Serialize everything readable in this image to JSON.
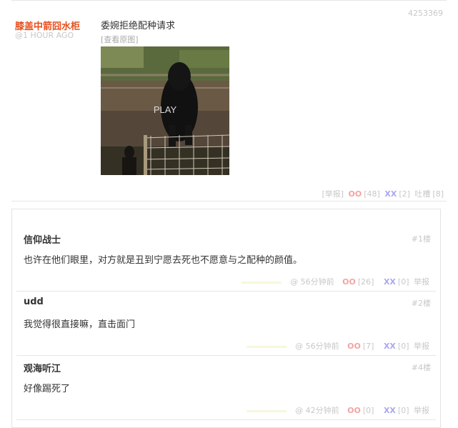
{
  "post": {
    "id": "4253369",
    "author": "膝盖中箭囧水柜",
    "time": "@1 HOUR AGO",
    "text": "委婉拒绝配种请求",
    "view_original": "[查看原图]",
    "media_label": "PLAY",
    "report": "[举报]",
    "oo_label": "OO",
    "oo_count": "[48]",
    "xx_label": "XX",
    "xx_count": "[2]",
    "tucao_label": "吐槽",
    "tucao_count": "[8]"
  },
  "comments": [
    {
      "author": "信仰战士",
      "floor": "#1楼",
      "text": "也许在他们眼里，对方就是丑到宁愿去死也不愿意与之配种的颜值。",
      "time": "@ 56分钟前",
      "oo_label": "OO",
      "oo": "[26]",
      "xx_label": "XX",
      "xx": "[0]",
      "report": "举报"
    },
    {
      "author": "udd",
      "floor": "#2楼",
      "text": "我觉得很直接嘛，直击面门",
      "time": "@ 56分钟前",
      "oo_label": "OO",
      "oo": "[7]",
      "xx_label": "XX",
      "xx": "[0]",
      "report": "举报"
    },
    {
      "author": "观海听江",
      "floor": "#4楼",
      "text": "好像踢死了",
      "time": "@ 42分钟前",
      "oo_label": "OO",
      "oo": "[0]",
      "xx_label": "XX",
      "xx": "[0]",
      "report": "举报"
    }
  ]
}
